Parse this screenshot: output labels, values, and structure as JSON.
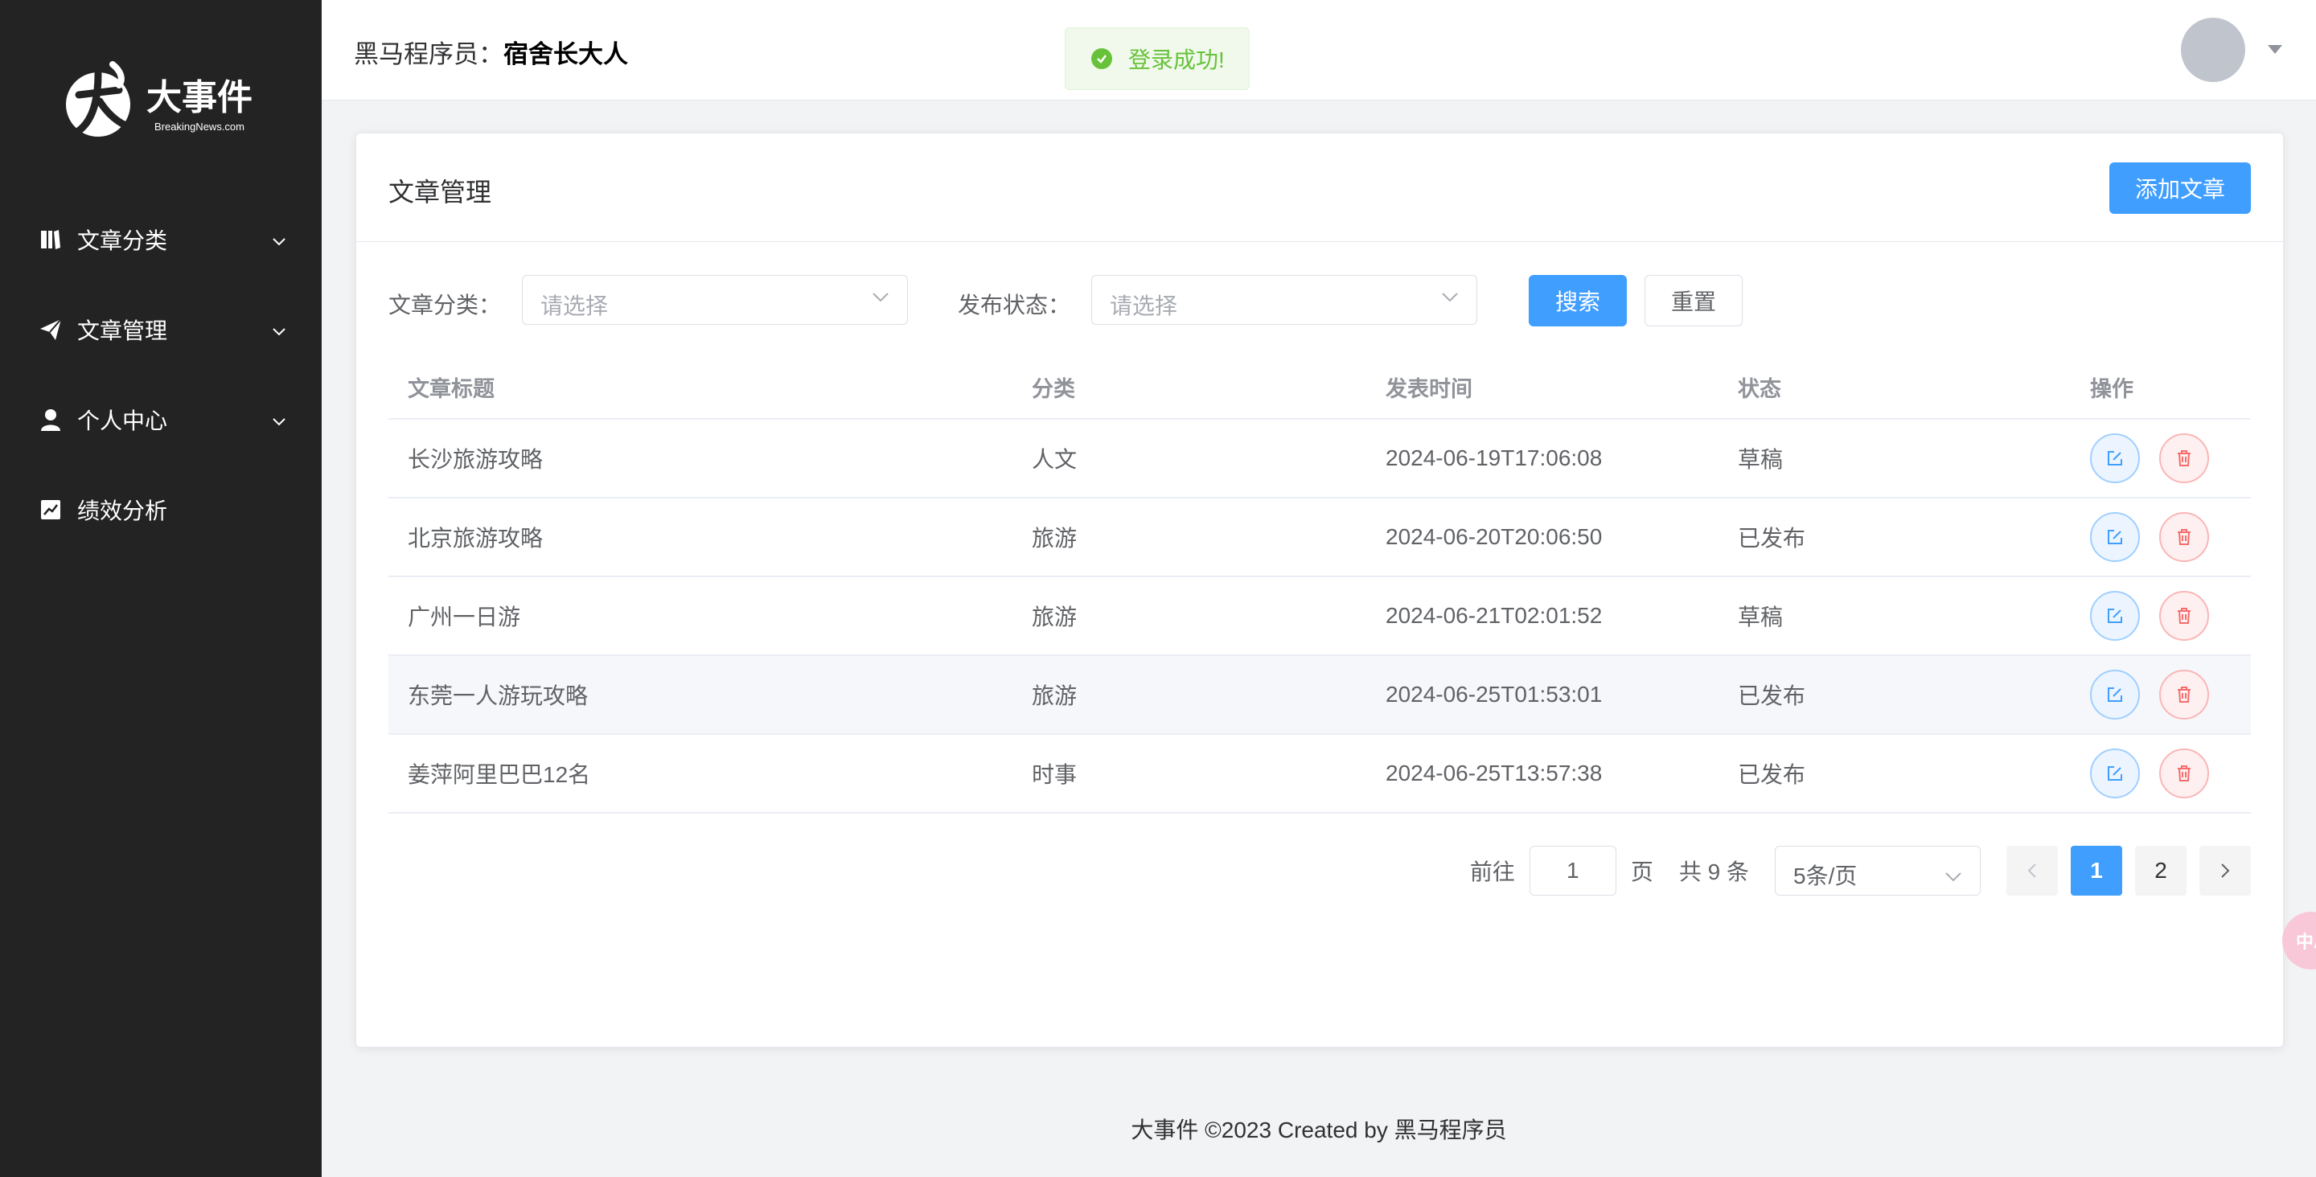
{
  "app": {
    "logo_text": "大事件",
    "logo_subtext": "BreakingNews.com"
  },
  "sidebar": {
    "items": [
      {
        "label": "文章分类",
        "icon": "book-icon",
        "has_submenu": true
      },
      {
        "label": "文章管理",
        "icon": "paper-plane-icon",
        "has_submenu": true
      },
      {
        "label": "个人中心",
        "icon": "user-icon",
        "has_submenu": true
      },
      {
        "label": "绩效分析",
        "icon": "chart-icon",
        "has_submenu": false
      }
    ]
  },
  "header": {
    "user_prefix": "黑马程序员：",
    "user_name": "宿舍长大人"
  },
  "toast": {
    "message": "登录成功!",
    "color": "#67c23a"
  },
  "card": {
    "title": "文章管理",
    "add_button": "添加文章"
  },
  "filters": {
    "category_label": "文章分类：",
    "category_placeholder": "请选择",
    "status_label": "发布状态：",
    "status_placeholder": "请选择",
    "search_button": "搜索",
    "reset_button": "重置"
  },
  "table": {
    "columns": [
      "文章标题",
      "分类",
      "发表时间",
      "状态",
      "操作"
    ],
    "rows": [
      {
        "title": "长沙旅游攻略",
        "category": "人文",
        "time": "2024-06-19T17:06:08",
        "status": "草稿"
      },
      {
        "title": "北京旅游攻略",
        "category": "旅游",
        "time": "2024-06-20T20:06:50",
        "status": "已发布"
      },
      {
        "title": "广州一日游",
        "category": "旅游",
        "time": "2024-06-21T02:01:52",
        "status": "草稿"
      },
      {
        "title": "东莞一人游玩攻略",
        "category": "旅游",
        "time": "2024-06-25T01:53:01",
        "status": "已发布"
      },
      {
        "title": "姜萍阿里巴巴12名",
        "category": "时事",
        "time": "2024-06-25T13:57:38",
        "status": "已发布"
      }
    ]
  },
  "pagination": {
    "goto_label": "前往",
    "goto_value": "1",
    "page_suffix": "页",
    "total_text": "共 9 条",
    "page_size": "5条/页",
    "pages": [
      "1",
      "2"
    ],
    "current_page": "1"
  },
  "footer": {
    "text": "大事件 ©2023 Created by 黑马程序员"
  },
  "colors": {
    "primary": "#409eff",
    "sidebar_bg": "#232323",
    "danger": "#f56c6c"
  }
}
